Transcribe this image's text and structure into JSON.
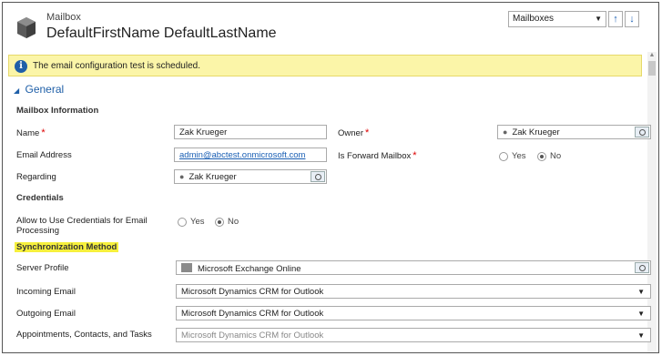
{
  "header": {
    "entity_type": "Mailbox",
    "entity_name": "DefaultFirstName DefaultLastName",
    "view_selector": "Mailboxes",
    "prev_label": "↑",
    "next_label": "↓"
  },
  "notification": {
    "icon": "info-icon",
    "message": "The email configuration test is scheduled."
  },
  "section": {
    "title": "General",
    "mailbox_info_heading": "Mailbox Information",
    "credentials_heading": "Credentials",
    "sync_heading": "Synchronization Method"
  },
  "fields": {
    "name_label": "Name",
    "name_value": "Zak Krueger",
    "owner_label": "Owner",
    "owner_value": "Zak Krueger",
    "email_label": "Email Address",
    "email_value": "admin@abctest.onmicrosoft.com",
    "forward_label": "Is Forward Mailbox",
    "forward_yes": "Yes",
    "forward_no": "No",
    "forward_selected": "No",
    "regarding_label": "Regarding",
    "regarding_value": "Zak Krueger",
    "cred_label": "Allow to Use Credentials for Email Processing",
    "cred_yes": "Yes",
    "cred_no": "No",
    "cred_selected": "No",
    "server_label": "Server Profile",
    "server_value": "Microsoft Exchange Online",
    "incoming_label": "Incoming Email",
    "incoming_value": "Microsoft Dynamics CRM for Outlook",
    "outgoing_label": "Outgoing Email",
    "outgoing_value": "Microsoft Dynamics CRM for Outlook",
    "appts_label": "Appointments, Contacts, and Tasks",
    "appts_value": "Microsoft Dynamics CRM for Outlook"
  },
  "required_marker": "*",
  "colors": {
    "accent": "#1f5fa8",
    "notification_bg": "#fbf5a8",
    "highlight": "#f6f03d",
    "required": "#dd0000"
  }
}
